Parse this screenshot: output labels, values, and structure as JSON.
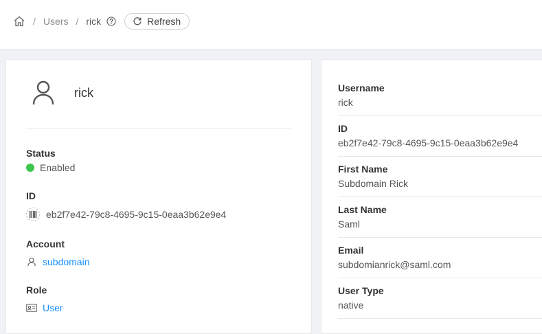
{
  "breadcrumb": {
    "home_icon": "home-icon",
    "separator": "/",
    "users_label": "Users",
    "current_label": "rick",
    "help_icon": "question-circle-icon"
  },
  "refresh": {
    "label": "Refresh",
    "icon": "reload-icon"
  },
  "profile": {
    "avatar_icon": "user-icon",
    "name": "rick"
  },
  "left_fields": {
    "status_label": "Status",
    "status_value": "Enabled",
    "status_color": "#3ec74f",
    "id_label": "ID",
    "id_value": "eb2f7e42-79c8-4695-9c15-0eaa3b62e9e4",
    "account_label": "Account",
    "account_value": "subdomain",
    "role_label": "Role",
    "role_value": "User"
  },
  "details": {
    "username_label": "Username",
    "username_value": "rick",
    "id_label": "ID",
    "id_value": "eb2f7e42-79c8-4695-9c15-0eaa3b62e9e4",
    "first_name_label": "First Name",
    "first_name_value": "Subdomain Rick",
    "last_name_label": "Last Name",
    "last_name_value": "Saml",
    "email_label": "Email",
    "email_value": "subdomianrick@saml.com",
    "user_type_label": "User Type",
    "user_type_value": "native"
  },
  "colors": {
    "link": "#1890ff",
    "background": "#f0f2f5"
  }
}
